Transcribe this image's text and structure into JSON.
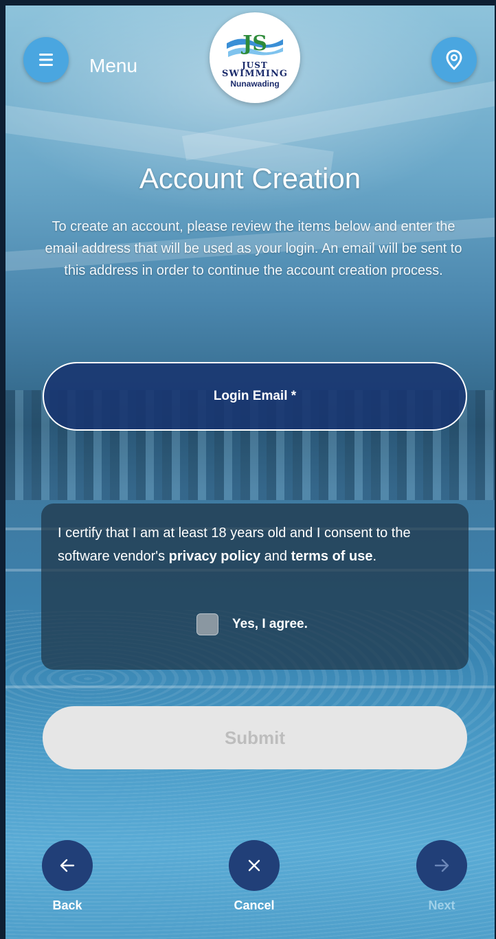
{
  "header": {
    "menu_label": "Menu",
    "menu_icon": "hamburger-icon",
    "location_icon": "location-pin-icon",
    "logo": {
      "line1": "JUST",
      "line2": "SWIMMING",
      "line3": "Nunawading",
      "monogram": "JS"
    }
  },
  "main": {
    "title": "Account Creation",
    "description": "To create an account, please review the items below and enter the email address that will be used as your login. An email will be sent to this address in order to continue the account creation process.",
    "email_placeholder": "Login Email *"
  },
  "consent": {
    "text_before": "I certify that I am at least 18 years old and I consent to the software vendor's ",
    "privacy_policy": "privacy policy",
    "and": " and ",
    "terms_of_use": "terms of use",
    "period": ".",
    "checkbox_label": "Yes, I agree.",
    "checked": false
  },
  "submit": {
    "label": "Submit",
    "enabled": false
  },
  "footer": {
    "back_label": "Back",
    "cancel_label": "Cancel",
    "next_label": "Next",
    "next_enabled": false
  },
  "colors": {
    "accent": "#4aa6e0",
    "nav_button": "#213f78",
    "email_field": "#183470"
  }
}
